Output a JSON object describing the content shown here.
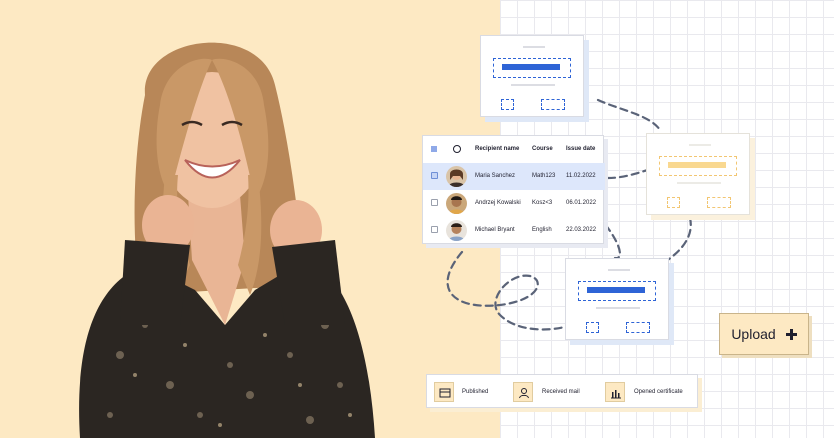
{
  "table": {
    "headers": {
      "name": "Recipient name",
      "course": "Course",
      "date": "Issue date"
    },
    "rows": [
      {
        "name": "Maria Sanchez",
        "course": "Math123",
        "date": "11.02.2022",
        "selected": true
      },
      {
        "name": "Andrzej Kowalski",
        "course": "Kosz<3",
        "date": "06.01.2022",
        "selected": false
      },
      {
        "name": "Michael Bryant",
        "course": "English",
        "date": "22.03.2022",
        "selected": false
      }
    ]
  },
  "upload": {
    "label": "Upload"
  },
  "legend": {
    "items": [
      {
        "label": "Published",
        "icon": "certificate-icon"
      },
      {
        "label": "Received mail",
        "icon": "user-icon"
      },
      {
        "label": "Opened certificate",
        "icon": "bar-chart-icon"
      }
    ]
  },
  "colors": {
    "accent_blue": "#2e64d6",
    "peach": "#fde9c3",
    "selected_row": "#dde7fb"
  }
}
